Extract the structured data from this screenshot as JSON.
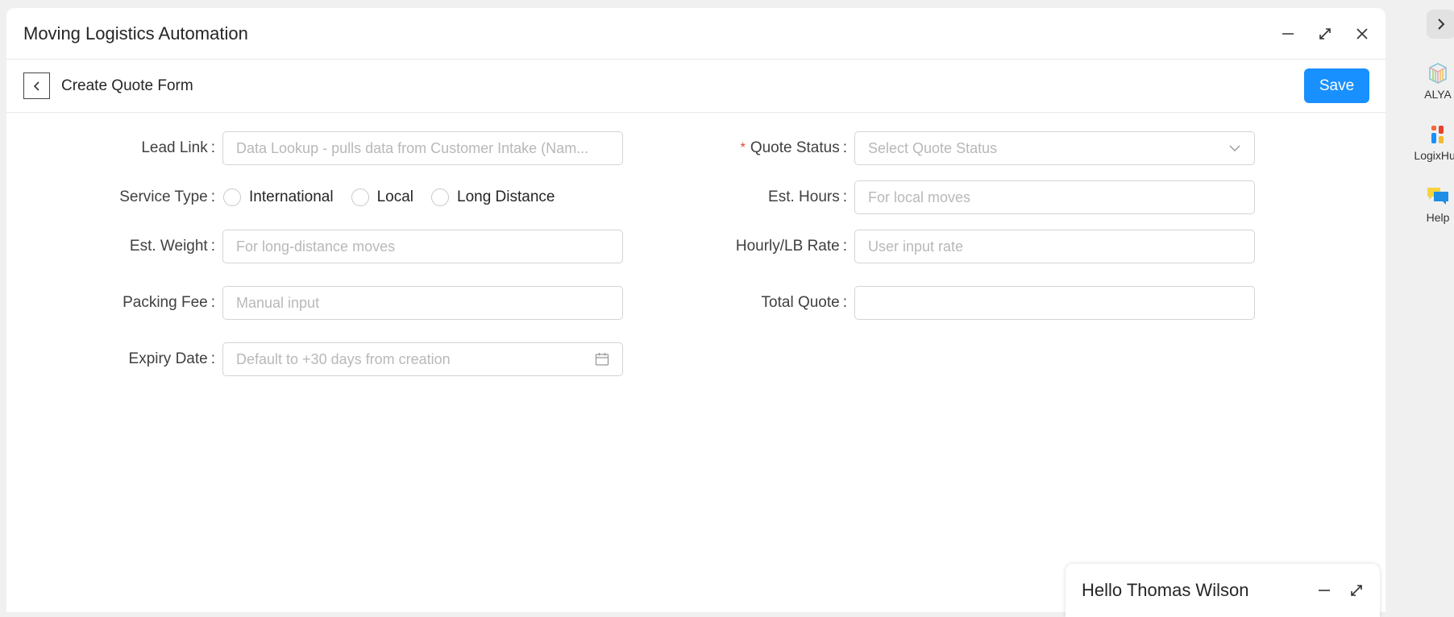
{
  "window": {
    "title": "Moving Logistics Automation"
  },
  "subbar": {
    "title": "Create Quote Form",
    "save_label": "Save"
  },
  "form": {
    "left": [
      {
        "label": "Lead Link",
        "placeholder": "Data Lookup - pulls data from Customer Intake (Nam..."
      },
      {
        "label": "Service Type",
        "options": [
          "International",
          "Local",
          "Long Distance"
        ]
      },
      {
        "label": "Est. Weight",
        "placeholder": "For long-distance moves"
      },
      {
        "label": "Packing Fee",
        "placeholder": "Manual input"
      },
      {
        "label": "Expiry Date",
        "placeholder": "Default to +30 days from creation"
      }
    ],
    "right": [
      {
        "label": "Quote Status",
        "required": true,
        "placeholder": "Select Quote Status"
      },
      {
        "label": "Est. Hours",
        "placeholder": "For local moves"
      },
      {
        "label": "Hourly/LB Rate",
        "placeholder": "User input rate"
      },
      {
        "label": "Total Quote",
        "placeholder": ""
      }
    ]
  },
  "chat": {
    "greeting": "Hello Thomas Wilson"
  },
  "rail": {
    "items": [
      {
        "label": "ALYA",
        "icon": "alya-icon"
      },
      {
        "label": "LogixHub",
        "icon": "logixhub-icon"
      },
      {
        "label": "Help",
        "icon": "help-chat-icon"
      }
    ]
  },
  "colors": {
    "accent": "#1890ff",
    "required": "#e8412e"
  }
}
